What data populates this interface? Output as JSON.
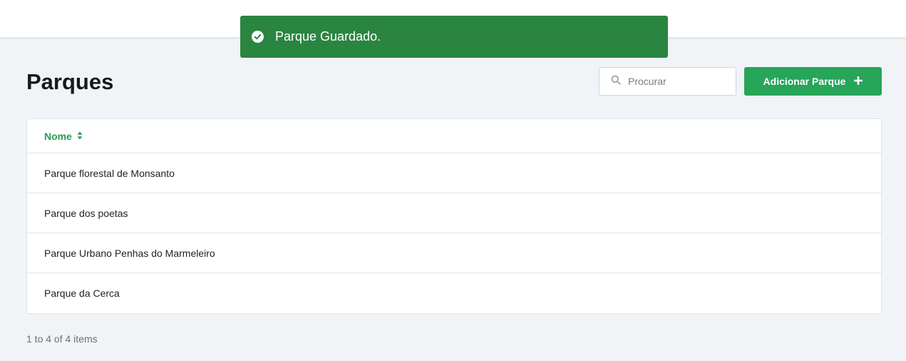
{
  "toast": {
    "message": "Parque Guardado.",
    "icon": "check-circle-icon",
    "color": "#2a8541"
  },
  "page": {
    "title": "Parques"
  },
  "search": {
    "placeholder": "Procurar",
    "value": "",
    "icon": "search-icon"
  },
  "add_button": {
    "label": "Adicionar Parque",
    "icon": "plus-icon",
    "color": "#27a559"
  },
  "table": {
    "columns": [
      {
        "label": "Nome",
        "sort_icon": "sort-icon"
      }
    ],
    "rows": [
      {
        "nome": "Parque florestal de Monsanto"
      },
      {
        "nome": "Parque dos poetas"
      },
      {
        "nome": "Parque Urbano Penhas do Marmeleiro"
      },
      {
        "nome": "Parque da Cerca"
      }
    ]
  },
  "pagination": {
    "summary": "1 to 4 of 4 items"
  }
}
